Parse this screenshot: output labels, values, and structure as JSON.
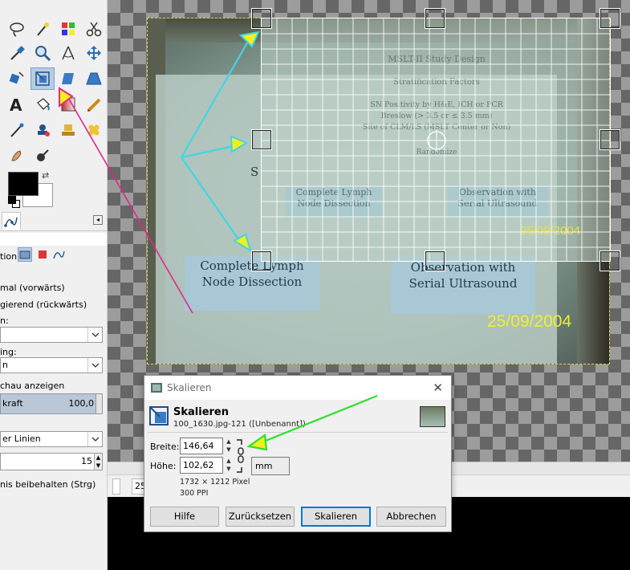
{
  "toolbox": {
    "tools": [
      "free-select",
      "fuzzy-select",
      "color-select",
      "scissors",
      "color-picker",
      "zoom",
      "measure",
      "move",
      "align",
      "scale",
      "shear",
      "perspective",
      "text",
      "bucket-fill",
      "blend",
      "pencil",
      "paintbrush",
      "airbrush",
      "heal",
      "clone",
      "smudge",
      "dodge"
    ],
    "active_tool": "scale",
    "options": {
      "transform_label": "tion:",
      "direction_normal": "mal (vorwärts)",
      "direction_corrective": "gierend (rückwärts)",
      "interpolation_label": "n:",
      "interpolation_value": "",
      "clipping_label": "ing:",
      "clipping_value": "n",
      "show_preview": "chau anzeigen",
      "opacity_label": "kraft",
      "opacity_value": "100,0",
      "guides_value": "er Linien",
      "guides_count": "15",
      "keep_aspect": "nis beibehalten (Strg)"
    }
  },
  "canvas": {
    "photo": {
      "box1": "Complete Lymph Node Dissection",
      "box2": "Observation with Serial Ultrasound",
      "date": "25/09/2004",
      "partial": "S"
    },
    "preview": {
      "title": "MSLT-II Study Design",
      "strat_label": "Stratification Factors",
      "line1": "SN Positivity by H&E, ICH or PCR",
      "line2": "Breslow (> 3.5 or ≤ 3.5 mm)",
      "line3": "Site of CLM/LS (MSLT Center or Non)",
      "line4": "Randomize",
      "box1": "Complete Lymph Node Dissection",
      "box2": "Observation with Serial Ultrasound",
      "date": "25/09/2004"
    }
  },
  "statusbar": {
    "zoom_value": "25"
  },
  "dialog": {
    "title": "Skalieren",
    "heading": "Skalieren",
    "subtitle": "100_1630.jpg-121 ([Unbenannt])",
    "width_label": "Breite:",
    "width_value": "146,64",
    "height_label": "Höhe:",
    "height_value": "102,62",
    "unit": "mm",
    "pixels_info": "1732 × 1212 Pixel",
    "ppi_info": "300 PPI",
    "buttons": {
      "help": "Hilfe",
      "reset": "Zurücksetzen",
      "scale": "Skalieren",
      "cancel": "Abbrechen"
    },
    "colors": {
      "default_button_border": "#0078d7"
    }
  },
  "annotations": {
    "cyan_color": "#3fd6e6",
    "green_color": "#2ee02e",
    "magenta_color": "#e0288a",
    "arrowhead_fill": "#f2f01a"
  }
}
